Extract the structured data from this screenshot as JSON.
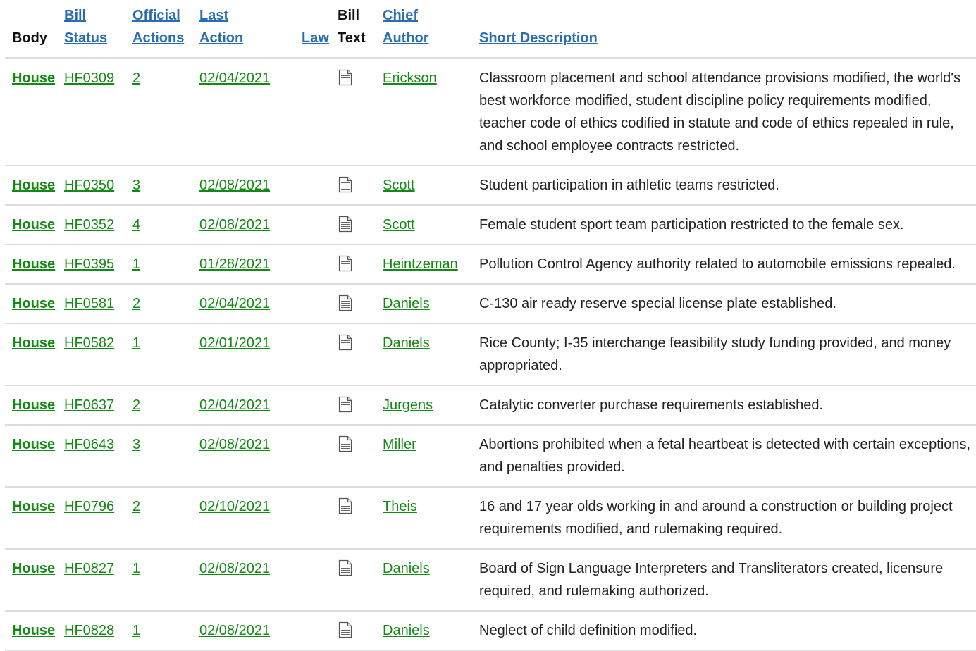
{
  "headers": {
    "body": "Body",
    "bill_status_1": "Bill",
    "bill_status_2": "Status",
    "official_actions_1": "Official",
    "official_actions_2": "Actions",
    "last_action_1": "Last",
    "last_action_2": "Action",
    "law": "Law",
    "bill_text_1": "Bill",
    "bill_text_2": "Text",
    "chief_author_1": "Chief",
    "chief_author_2": "Author",
    "short_description": "Short Description"
  },
  "icons": {
    "bill_text": "document-icon"
  },
  "colors": {
    "link_green": "#138a13",
    "header_link_blue": "#2a6db0",
    "row_border": "#dcdcdc"
  },
  "rows": [
    {
      "body": "House",
      "bill": "HF0309",
      "actions": "2",
      "last_action": "02/04/2021",
      "law": "",
      "author": "Erickson",
      "description": "Classroom placement and school attendance provisions modified, the world's best workforce modified, student discipline policy requirements modified, teacher code of ethics codified in statute and code of ethics repealed in rule, and school employee contracts restricted."
    },
    {
      "body": "House",
      "bill": "HF0350",
      "actions": "3",
      "last_action": "02/08/2021",
      "law": "",
      "author": "Scott",
      "description": "Student participation in athletic teams restricted."
    },
    {
      "body": "House",
      "bill": "HF0352",
      "actions": "4",
      "last_action": "02/08/2021",
      "law": "",
      "author": "Scott",
      "description": "Female student sport team participation restricted to the female sex."
    },
    {
      "body": "House",
      "bill": "HF0395",
      "actions": "1",
      "last_action": "01/28/2021",
      "law": "",
      "author": "Heintzeman",
      "description": "Pollution Control Agency authority related to automobile emissions repealed."
    },
    {
      "body": "House",
      "bill": "HF0581",
      "actions": "2",
      "last_action": "02/04/2021",
      "law": "",
      "author": "Daniels",
      "description": "C-130 air ready reserve special license plate established."
    },
    {
      "body": "House",
      "bill": "HF0582",
      "actions": "1",
      "last_action": "02/01/2021",
      "law": "",
      "author": "Daniels",
      "description": "Rice County; I-35 interchange feasibility study funding provided, and money appropriated."
    },
    {
      "body": "House",
      "bill": "HF0637",
      "actions": "2",
      "last_action": "02/04/2021",
      "law": "",
      "author": "Jurgens",
      "description": "Catalytic converter purchase requirements established."
    },
    {
      "body": "House",
      "bill": "HF0643",
      "actions": "3",
      "last_action": "02/08/2021",
      "law": "",
      "author": "Miller",
      "description": "Abortions prohibited when a fetal heartbeat is detected with certain exceptions, and penalties provided."
    },
    {
      "body": "House",
      "bill": "HF0796",
      "actions": "2",
      "last_action": "02/10/2021",
      "law": "",
      "author": "Theis",
      "description": "16 and 17 year olds working in and around a construction or building project requirements modified, and rulemaking required."
    },
    {
      "body": "House",
      "bill": "HF0827",
      "actions": "1",
      "last_action": "02/08/2021",
      "law": "",
      "author": "Daniels",
      "description": "Board of Sign Language Interpreters and Transliterators created, licensure required, and rulemaking authorized."
    },
    {
      "body": "House",
      "bill": "HF0828",
      "actions": "1",
      "last_action": "02/08/2021",
      "law": "",
      "author": "Daniels",
      "description": "Neglect of child definition modified."
    }
  ]
}
